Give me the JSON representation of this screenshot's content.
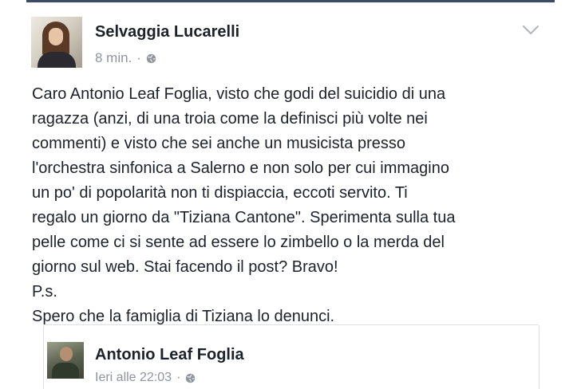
{
  "post": {
    "author": "Selvaggia Lucarelli",
    "time": "8 min.",
    "separator": "·",
    "privacy_icon": "globe-icon",
    "options_icon": "chevron-down-icon",
    "body": "Caro Antonio Leaf Foglia, visto che godi del suicidio di una\nragazza (anzi, di una troia come la definisci più volte nei\ncommenti) e visto che sei anche un musicista presso\nl'orchestra sinfonica a Salerno e non solo per cui immagino\nun po' di popolarità  non ti dispiaccia, eccoti servito. Ti\nregalo un giorno da \"Tiziana Cantone\". Sperimenta sulla tua\npelle come ci si sente ad essere lo zimbello o la merda del\ngiorno sul web. Stai facendo il post? Bravo!\nP.s.\nSpero che la famiglia di Tiziana lo denunci."
  },
  "shared": {
    "author": "Antonio Leaf Foglia",
    "time": "Ieri alle 22:03",
    "separator": "·",
    "privacy_icon": "globe-icon"
  },
  "colors": {
    "text": "#1d2129",
    "meta": "#90949c",
    "border": "#dddfe2",
    "top_rule": "#3b4a66"
  }
}
